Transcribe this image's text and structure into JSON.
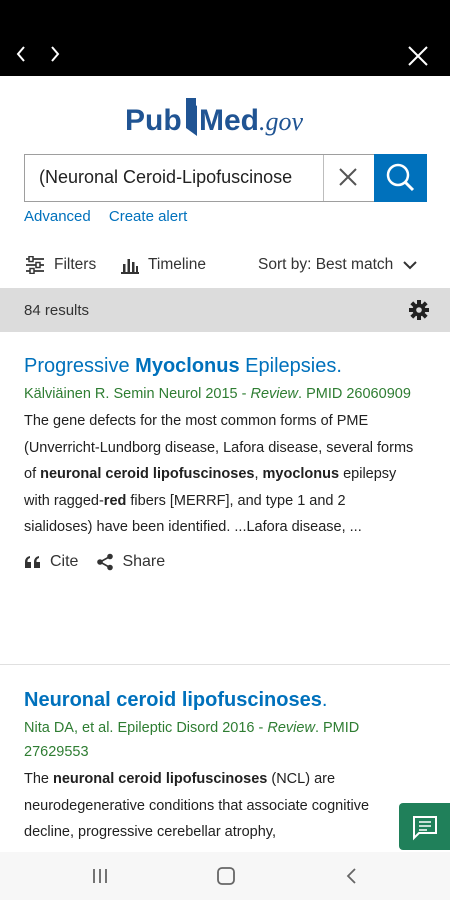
{
  "browser": {
    "back_icon": "chevron-left-icon",
    "forward_icon": "chevron-right-icon",
    "close_icon": "close-icon"
  },
  "brand": {
    "name_pub": "Pub",
    "name_med": "Med",
    "suffix": ".gov"
  },
  "search": {
    "value": "(Neuronal Ceroid-Lipofuscinose",
    "advanced_label": "Advanced",
    "create_alert_label": "Create alert"
  },
  "toolbar": {
    "filters_label": "Filters",
    "timeline_label": "Timeline",
    "sort_label": "Sort by: Best match"
  },
  "results": {
    "count_label": "84 results"
  },
  "articles": [
    {
      "title_pre": "Progressive ",
      "title_bold": "Myoclonus",
      "title_post": " Epilepsies.",
      "meta_authors": "Kälviäinen R. Semin Neurol 2015 - ",
      "meta_type": "Review",
      "meta_pmid": ". PMID 26060909",
      "snippet": [
        {
          "t": "The gene defects for the most common forms of PME (Unverricht-Lundborg disease, Lafora disease, several forms of ",
          "b": false
        },
        {
          "t": "neuronal ceroid lipofuscinoses",
          "b": true
        },
        {
          "t": ", ",
          "b": false
        },
        {
          "t": "myoclonus",
          "b": true
        },
        {
          "t": " epilepsy with ragged-",
          "b": false
        },
        {
          "t": "red",
          "b": true
        },
        {
          "t": " fibers [MERRF], and type 1 and 2 sialidoses) have been identified. ...Lafora disease, ...",
          "b": false
        }
      ],
      "cite_label": "Cite",
      "share_label": "Share"
    },
    {
      "title_pre": "",
      "title_bold": "Neuronal ceroid lipofuscinoses",
      "title_post": ".",
      "meta_authors": "Nita DA, et al. Epileptic Disord 2016 - ",
      "meta_type": "Review",
      "meta_pmid": ". PMID 27629553",
      "snippet": [
        {
          "t": "The ",
          "b": false
        },
        {
          "t": "neuronal ceroid lipofuscinoses",
          "b": true
        },
        {
          "t": " (NCL) are neurodegenerative conditions that associate cognitive decline, progressive cerebellar atrophy,",
          "b": false
        }
      ]
    }
  ],
  "colors": {
    "link": "#0071bc",
    "meta": "#2e7d32",
    "fab": "#20805a"
  }
}
